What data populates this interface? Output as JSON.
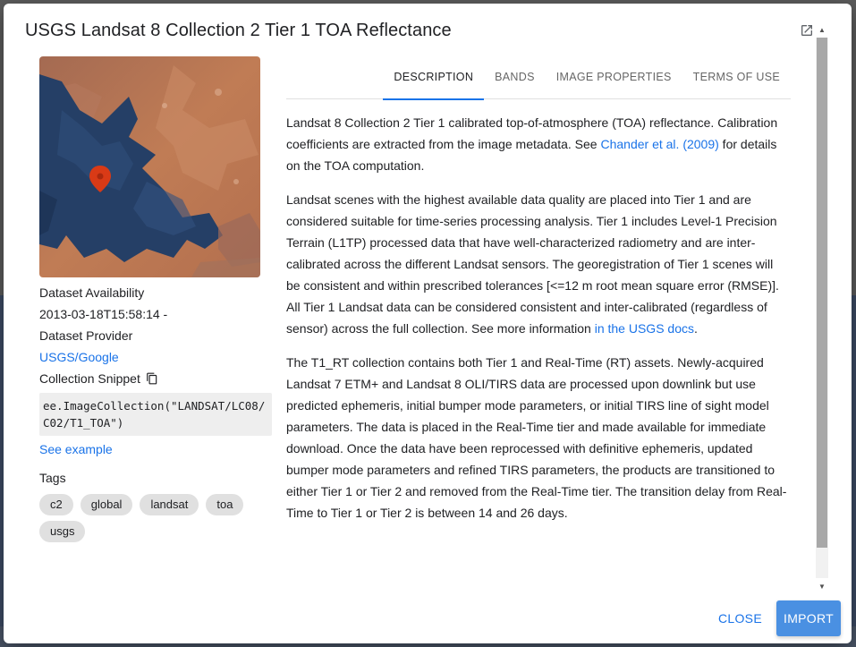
{
  "dialog": {
    "title": "USGS Landsat 8 Collection 2 Tier 1 TOA Reflectance",
    "open_icon": "open-in-new-icon"
  },
  "thumbnail": {
    "marker_icon": "map-pin-icon",
    "colors": {
      "land": "#b56e4a",
      "water": "#1e3558",
      "marker": "#d93a16"
    }
  },
  "meta": {
    "availability_label": "Dataset Availability",
    "availability_value": "2013-03-18T15:58:14 -",
    "provider_label": "Dataset Provider",
    "provider_value": "USGS/Google",
    "snippet_label": "Collection Snippet",
    "copy_icon": "copy-icon",
    "snippet_code": "ee.ImageCollection(\"LANDSAT/LC08/C02/T1_TOA\")",
    "see_example": "See example",
    "tags_label": "Tags",
    "tags": [
      "c2",
      "global",
      "landsat",
      "toa",
      "usgs"
    ]
  },
  "tabs": [
    {
      "label": "DESCRIPTION",
      "active": true
    },
    {
      "label": "BANDS",
      "active": false
    },
    {
      "label": "IMAGE PROPERTIES",
      "active": false
    },
    {
      "label": "TERMS OF USE",
      "active": false
    }
  ],
  "description": {
    "p1_a": "Landsat 8 Collection 2 Tier 1 calibrated top-of-atmosphere (TOA) reflectance. Calibration coefficients are extracted from the image metadata. See ",
    "p1_link": "Chander et al. (2009)",
    "p1_b": " for details on the TOA computation.",
    "p2_a": "Landsat scenes with the highest available data quality are placed into Tier 1 and are considered suitable for time-series processing analysis. Tier 1 includes Level-1 Precision Terrain (L1TP) processed data that have well-characterized radiometry and are inter-calibrated across the different Landsat sensors. The georegistration of Tier 1 scenes will be consistent and within prescribed tolerances [<=12 m root mean square error (RMSE)]. All Tier 1 Landsat data can be considered consistent and inter-calibrated (regardless of sensor) across the full collection. See more information ",
    "p2_link": "in the USGS docs",
    "p2_b": ".",
    "p3": "The T1_RT collection contains both Tier 1 and Real-Time (RT) assets. Newly-acquired Landsat 7 ETM+ and Landsat 8 OLI/TIRS data are processed upon downlink but use predicted ephemeris, initial bumper mode parameters, or initial TIRS line of sight model parameters. The data is placed in the Real-Time tier and made available for immediate download. Once the data have been reprocessed with definitive ephemeris, updated bumper mode parameters and refined TIRS parameters, the products are transitioned to either Tier 1 or Tier 2 and removed from the Real-Time tier. The transition delay from Real-Time to Tier 1 or Tier 2 is between 14 and 26 days."
  },
  "footer": {
    "close_label": "CLOSE",
    "import_label": "IMPORT"
  },
  "colors": {
    "accent": "#1a73e8",
    "import_bg": "#4a90e2"
  }
}
